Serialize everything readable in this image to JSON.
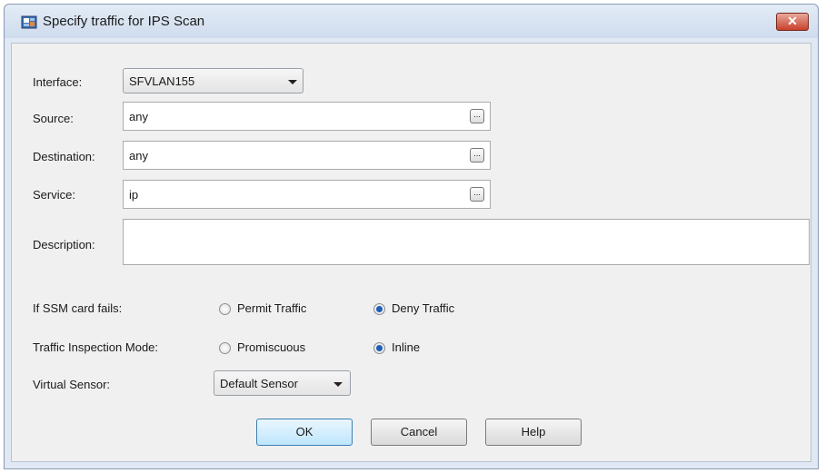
{
  "window": {
    "title": "Specify traffic for IPS Scan",
    "close_label": "✕"
  },
  "form": {
    "interface_label": "Interface:",
    "interface_value": "SFVLAN155",
    "source_label": "Source:",
    "source_value": "any",
    "destination_label": "Destination:",
    "destination_value": "any",
    "service_label": "Service:",
    "service_value": "ip",
    "description_label": "Description:",
    "description_value": "",
    "browse_label": "..."
  },
  "ssm": {
    "label": "If SSM card fails:",
    "options": [
      {
        "label": "Permit Traffic",
        "checked": false
      },
      {
        "label": "Deny Traffic",
        "checked": true
      }
    ]
  },
  "inspection": {
    "label": "Traffic Inspection Mode:",
    "options": [
      {
        "label": "Promiscuous",
        "checked": false
      },
      {
        "label": "Inline",
        "checked": true
      }
    ]
  },
  "sensor": {
    "label": "Virtual Sensor:",
    "value": "Default Sensor"
  },
  "buttons": {
    "ok": "OK",
    "cancel": "Cancel",
    "help": "Help"
  },
  "colors": {
    "close_button": "#c7402c",
    "radio_selected": "#1e5fb8",
    "default_button_border": "#3c7fb1"
  }
}
